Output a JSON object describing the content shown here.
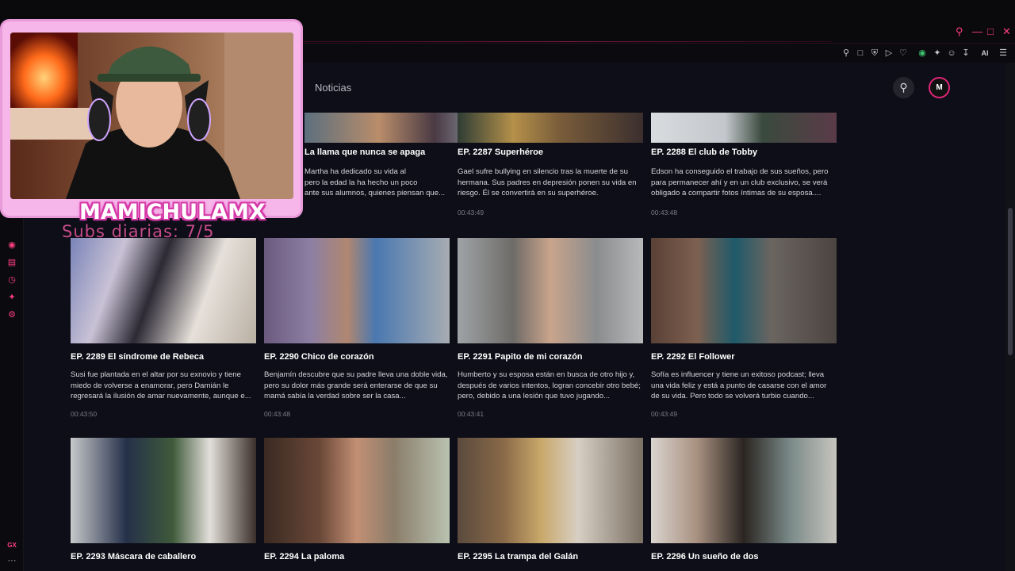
{
  "nav": {
    "noticias": "Noticias"
  },
  "user": {
    "avatar_letter": "M"
  },
  "browser": {
    "ai_label": "AI",
    "sidebar_bottom": "GX"
  },
  "overlay": {
    "streamer_name": "MAMICHULAMX",
    "subs_text": "Subs diarias: 7/5"
  },
  "row1": [
    {
      "title": "La llama que nunca se apaga",
      "desc": "Martha ha dedicado su vida al\npero la edad la ha hecho un poco\nante sus alumnos, quienes piensan que...",
      "duration": ""
    },
    {
      "title": "EP. 2287  Superhéroe",
      "desc": "Gael sufre bullying en silencio tras la muerte de su hermana. Sus padres en depresión ponen su vida en riesgo. Él se convertirá en su superhéroe.",
      "duration": "00:43:49"
    },
    {
      "title": "EP. 2288  El club de Tobby",
      "desc": "Edson ha conseguido el trabajo de sus sueños, pero para permanecer ahí y en un club exclusivo, se verá obligado a compartir fotos íntimas de su esposa....",
      "duration": "00:43:48"
    }
  ],
  "row2": [
    {
      "title": "EP. 2289  El síndrome de Rebeca",
      "desc": "Susi fue plantada en el altar por su exnovio y tiene miedo de volverse a enamorar, pero Damián le regresará la ilusión de amar nuevamente, aunque e...",
      "duration": "00:43:50"
    },
    {
      "title": "EP. 2290  Chico de corazón",
      "desc": "Benjamín descubre que su padre lleva una doble vida, pero su dolor más grande será enterarse de que su mamá sabía la verdad sobre ser la casa...",
      "duration": "00:43:48"
    },
    {
      "title": "EP. 2291  Papito de mi corazón",
      "desc": "Humberto y su esposa están en busca de otro hijo y, después de varios intentos, logran concebir otro bebé; pero, debido a una lesión que tuvo jugando...",
      "duration": "00:43:41"
    },
    {
      "title": "EP. 2292  El Follower",
      "desc": "Sofía es influencer y tiene un exitoso podcast; lleva una vida feliz y está a punto de casarse con el amor de su vida. Pero todo se volverá turbio cuando...",
      "duration": "00:43:49"
    }
  ],
  "row3": [
    {
      "title": "EP. 2293  Máscara de caballero"
    },
    {
      "title": "EP. 2294  La paloma"
    },
    {
      "title": "EP. 2295  La trampa del Galán"
    },
    {
      "title": "EP. 2296  Un sueño de dos"
    }
  ]
}
